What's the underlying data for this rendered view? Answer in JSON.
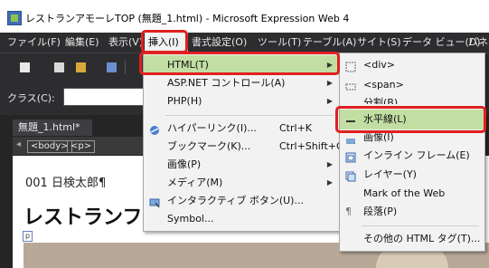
{
  "window": {
    "title": "レストランアモーレTOP (無題_1.html) - Microsoft Expression Web 4"
  },
  "menubar": {
    "items": [
      "ファイル(F)",
      "編集(E)",
      "表示(V)",
      "挿入(I)",
      "書式設定(O)",
      "ツール(T)",
      "テーブル(A)",
      "サイト(S)",
      "データ ビュー(D)",
      "パネ"
    ]
  },
  "classbar": {
    "label": "クラス(C):"
  },
  "document": {
    "tab": "無題_1.html*",
    "tab_close": "×",
    "tags": [
      "<body>",
      "<p>"
    ],
    "line1": "001 日検太郎¶",
    "heading": "レストランフ",
    "p_marker": "p"
  },
  "insert_menu": {
    "items": [
      {
        "label": "HTML(T)",
        "shortcut": "",
        "submenu": true,
        "icon": ""
      },
      {
        "label": "ASP.NET コントロール(A)",
        "shortcut": "",
        "submenu": true,
        "icon": ""
      },
      {
        "label": "PHP(H)",
        "shortcut": "",
        "submenu": true,
        "icon": ""
      },
      {
        "label": "ハイパーリンク(I)...",
        "shortcut": "Ctrl+K",
        "submenu": false,
        "icon": "hyperlink-icon"
      },
      {
        "label": "ブックマーク(K)...",
        "shortcut": "Ctrl+Shift+G",
        "submenu": false,
        "icon": ""
      },
      {
        "label": "画像(P)",
        "shortcut": "",
        "submenu": true,
        "icon": ""
      },
      {
        "label": "メディア(M)",
        "shortcut": "",
        "submenu": true,
        "icon": ""
      },
      {
        "label": "インタラクティブ ボタン(U)...",
        "shortcut": "",
        "submenu": false,
        "icon": "interactive-button-icon"
      },
      {
        "label": "Symbol...",
        "shortcut": "",
        "submenu": false,
        "icon": ""
      }
    ]
  },
  "html_submenu": {
    "items": [
      {
        "label": "<div>",
        "icon": "div-icon"
      },
      {
        "label": "<span>",
        "icon": "span-icon"
      },
      {
        "label": "分割(B)",
        "icon": "break-icon"
      },
      {
        "label": "水平線(L)",
        "icon": "horizontal-line-icon"
      },
      {
        "label": "画像(I)",
        "icon": "image-icon"
      },
      {
        "label": "インライン フレーム(E)",
        "icon": "inline-frame-icon"
      },
      {
        "label": "レイヤー(Y)",
        "icon": "layer-icon"
      },
      {
        "label": "Mark of the Web",
        "icon": ""
      },
      {
        "label": "段落(P)",
        "icon": "paragraph-icon"
      },
      {
        "label": "その他の HTML タグ(T)...",
        "icon": ""
      }
    ]
  },
  "colors": {
    "highlight": "#c3dea3",
    "callout": "#e02020",
    "chrome": "#2d2d30"
  }
}
